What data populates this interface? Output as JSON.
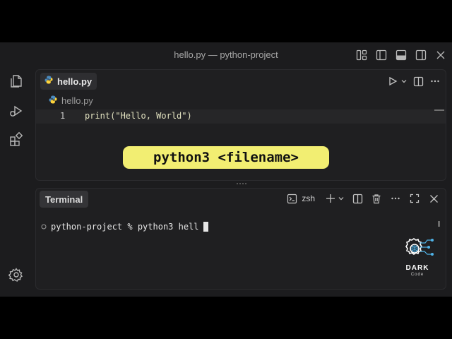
{
  "window": {
    "title": "hello.py — python-project"
  },
  "editor": {
    "tab_label": "hello.py",
    "breadcrumb": "hello.py",
    "lines": [
      {
        "number": "1",
        "code": "print(\"Hello, World\")"
      }
    ]
  },
  "callout": {
    "text": "python3 <filename>"
  },
  "terminal": {
    "tab_label": "Terminal",
    "shell": "zsh",
    "prompt_line": "python-project % python3 hell"
  },
  "logo": {
    "dark": "DARK",
    "code": "Code"
  },
  "icons": {
    "activity": [
      "files-icon",
      "run-debug-icon",
      "extensions-icon",
      "settings-gear-icon"
    ],
    "python": "python-file-icon"
  },
  "colors": {
    "callout_bg": "#f2ee72",
    "python_blue": "#4b8bbe",
    "python_yellow": "#ffd43b",
    "logo_accent": "#4fb3e8"
  }
}
